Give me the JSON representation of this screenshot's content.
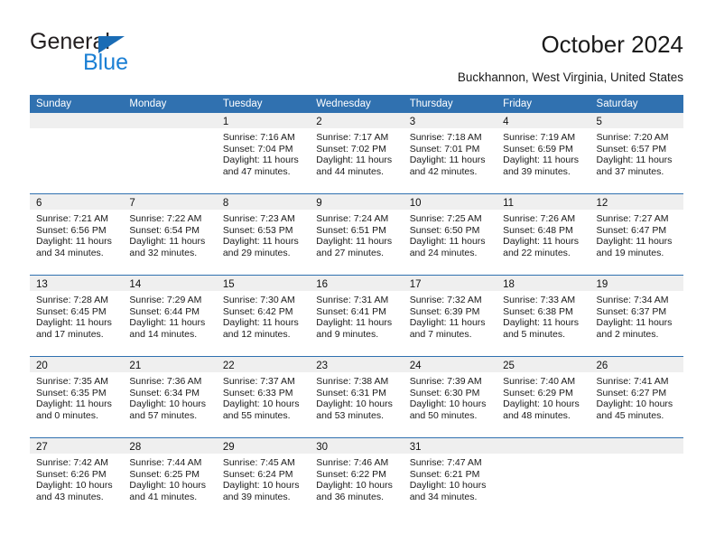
{
  "brand": {
    "name_top": "General",
    "name_bottom": "Blue",
    "logo_icon": "triangle-icon",
    "color_dark": "#231f20",
    "color_blue": "#1a7fd4"
  },
  "header": {
    "title": "October 2024",
    "location": "Buckhannon, West Virginia, United States"
  },
  "theme": {
    "header_blue": "#3071b0",
    "daynum_band": "#efefef",
    "text": "#1a1a1a"
  },
  "calendar": {
    "weekdays": [
      "Sunday",
      "Monday",
      "Tuesday",
      "Wednesday",
      "Thursday",
      "Friday",
      "Saturday"
    ],
    "weeks": [
      [
        {
          "day": "",
          "empty": true
        },
        {
          "day": "",
          "empty": true
        },
        {
          "day": "1",
          "sunrise": "Sunrise: 7:16 AM",
          "sunset": "Sunset: 7:04 PM",
          "daylight1": "Daylight: 11 hours",
          "daylight2": "and 47 minutes."
        },
        {
          "day": "2",
          "sunrise": "Sunrise: 7:17 AM",
          "sunset": "Sunset: 7:02 PM",
          "daylight1": "Daylight: 11 hours",
          "daylight2": "and 44 minutes."
        },
        {
          "day": "3",
          "sunrise": "Sunrise: 7:18 AM",
          "sunset": "Sunset: 7:01 PM",
          "daylight1": "Daylight: 11 hours",
          "daylight2": "and 42 minutes."
        },
        {
          "day": "4",
          "sunrise": "Sunrise: 7:19 AM",
          "sunset": "Sunset: 6:59 PM",
          "daylight1": "Daylight: 11 hours",
          "daylight2": "and 39 minutes."
        },
        {
          "day": "5",
          "sunrise": "Sunrise: 7:20 AM",
          "sunset": "Sunset: 6:57 PM",
          "daylight1": "Daylight: 11 hours",
          "daylight2": "and 37 minutes."
        }
      ],
      [
        {
          "day": "6",
          "sunrise": "Sunrise: 7:21 AM",
          "sunset": "Sunset: 6:56 PM",
          "daylight1": "Daylight: 11 hours",
          "daylight2": "and 34 minutes."
        },
        {
          "day": "7",
          "sunrise": "Sunrise: 7:22 AM",
          "sunset": "Sunset: 6:54 PM",
          "daylight1": "Daylight: 11 hours",
          "daylight2": "and 32 minutes."
        },
        {
          "day": "8",
          "sunrise": "Sunrise: 7:23 AM",
          "sunset": "Sunset: 6:53 PM",
          "daylight1": "Daylight: 11 hours",
          "daylight2": "and 29 minutes."
        },
        {
          "day": "9",
          "sunrise": "Sunrise: 7:24 AM",
          "sunset": "Sunset: 6:51 PM",
          "daylight1": "Daylight: 11 hours",
          "daylight2": "and 27 minutes."
        },
        {
          "day": "10",
          "sunrise": "Sunrise: 7:25 AM",
          "sunset": "Sunset: 6:50 PM",
          "daylight1": "Daylight: 11 hours",
          "daylight2": "and 24 minutes."
        },
        {
          "day": "11",
          "sunrise": "Sunrise: 7:26 AM",
          "sunset": "Sunset: 6:48 PM",
          "daylight1": "Daylight: 11 hours",
          "daylight2": "and 22 minutes."
        },
        {
          "day": "12",
          "sunrise": "Sunrise: 7:27 AM",
          "sunset": "Sunset: 6:47 PM",
          "daylight1": "Daylight: 11 hours",
          "daylight2": "and 19 minutes."
        }
      ],
      [
        {
          "day": "13",
          "sunrise": "Sunrise: 7:28 AM",
          "sunset": "Sunset: 6:45 PM",
          "daylight1": "Daylight: 11 hours",
          "daylight2": "and 17 minutes."
        },
        {
          "day": "14",
          "sunrise": "Sunrise: 7:29 AM",
          "sunset": "Sunset: 6:44 PM",
          "daylight1": "Daylight: 11 hours",
          "daylight2": "and 14 minutes."
        },
        {
          "day": "15",
          "sunrise": "Sunrise: 7:30 AM",
          "sunset": "Sunset: 6:42 PM",
          "daylight1": "Daylight: 11 hours",
          "daylight2": "and 12 minutes."
        },
        {
          "day": "16",
          "sunrise": "Sunrise: 7:31 AM",
          "sunset": "Sunset: 6:41 PM",
          "daylight1": "Daylight: 11 hours",
          "daylight2": "and 9 minutes."
        },
        {
          "day": "17",
          "sunrise": "Sunrise: 7:32 AM",
          "sunset": "Sunset: 6:39 PM",
          "daylight1": "Daylight: 11 hours",
          "daylight2": "and 7 minutes."
        },
        {
          "day": "18",
          "sunrise": "Sunrise: 7:33 AM",
          "sunset": "Sunset: 6:38 PM",
          "daylight1": "Daylight: 11 hours",
          "daylight2": "and 5 minutes."
        },
        {
          "day": "19",
          "sunrise": "Sunrise: 7:34 AM",
          "sunset": "Sunset: 6:37 PM",
          "daylight1": "Daylight: 11 hours",
          "daylight2": "and 2 minutes."
        }
      ],
      [
        {
          "day": "20",
          "sunrise": "Sunrise: 7:35 AM",
          "sunset": "Sunset: 6:35 PM",
          "daylight1": "Daylight: 11 hours",
          "daylight2": "and 0 minutes."
        },
        {
          "day": "21",
          "sunrise": "Sunrise: 7:36 AM",
          "sunset": "Sunset: 6:34 PM",
          "daylight1": "Daylight: 10 hours",
          "daylight2": "and 57 minutes."
        },
        {
          "day": "22",
          "sunrise": "Sunrise: 7:37 AM",
          "sunset": "Sunset: 6:33 PM",
          "daylight1": "Daylight: 10 hours",
          "daylight2": "and 55 minutes."
        },
        {
          "day": "23",
          "sunrise": "Sunrise: 7:38 AM",
          "sunset": "Sunset: 6:31 PM",
          "daylight1": "Daylight: 10 hours",
          "daylight2": "and 53 minutes."
        },
        {
          "day": "24",
          "sunrise": "Sunrise: 7:39 AM",
          "sunset": "Sunset: 6:30 PM",
          "daylight1": "Daylight: 10 hours",
          "daylight2": "and 50 minutes."
        },
        {
          "day": "25",
          "sunrise": "Sunrise: 7:40 AM",
          "sunset": "Sunset: 6:29 PM",
          "daylight1": "Daylight: 10 hours",
          "daylight2": "and 48 minutes."
        },
        {
          "day": "26",
          "sunrise": "Sunrise: 7:41 AM",
          "sunset": "Sunset: 6:27 PM",
          "daylight1": "Daylight: 10 hours",
          "daylight2": "and 45 minutes."
        }
      ],
      [
        {
          "day": "27",
          "sunrise": "Sunrise: 7:42 AM",
          "sunset": "Sunset: 6:26 PM",
          "daylight1": "Daylight: 10 hours",
          "daylight2": "and 43 minutes."
        },
        {
          "day": "28",
          "sunrise": "Sunrise: 7:44 AM",
          "sunset": "Sunset: 6:25 PM",
          "daylight1": "Daylight: 10 hours",
          "daylight2": "and 41 minutes."
        },
        {
          "day": "29",
          "sunrise": "Sunrise: 7:45 AM",
          "sunset": "Sunset: 6:24 PM",
          "daylight1": "Daylight: 10 hours",
          "daylight2": "and 39 minutes."
        },
        {
          "day": "30",
          "sunrise": "Sunrise: 7:46 AM",
          "sunset": "Sunset: 6:22 PM",
          "daylight1": "Daylight: 10 hours",
          "daylight2": "and 36 minutes."
        },
        {
          "day": "31",
          "sunrise": "Sunrise: 7:47 AM",
          "sunset": "Sunset: 6:21 PM",
          "daylight1": "Daylight: 10 hours",
          "daylight2": "and 34 minutes."
        },
        {
          "day": "",
          "empty": true
        },
        {
          "day": "",
          "empty": true
        }
      ]
    ]
  }
}
